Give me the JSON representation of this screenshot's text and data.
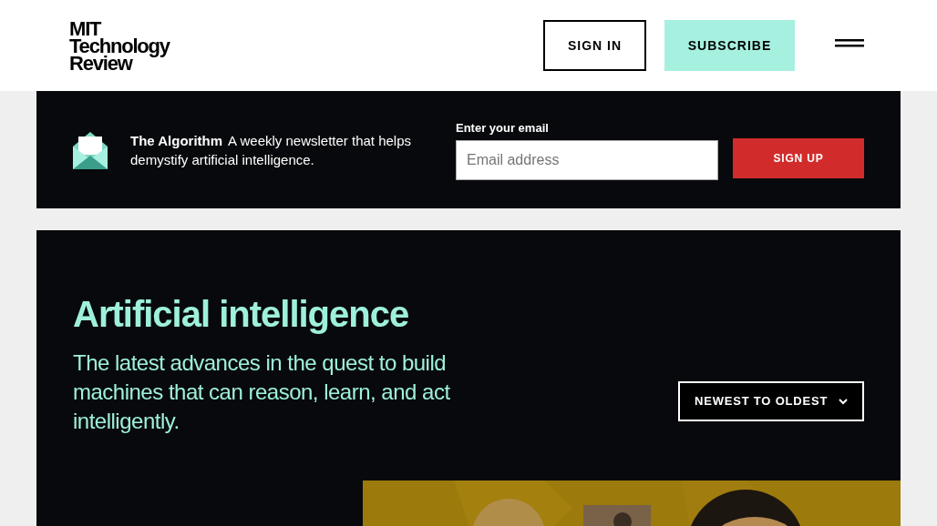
{
  "header": {
    "logo_lines": [
      "MIT",
      "Technology",
      "Review"
    ],
    "sign_in": "SIGN IN",
    "subscribe": "SUBSCRIBE"
  },
  "newsletter": {
    "name": "The Algorithm",
    "description": "A weekly newsletter that helps demystify artificial intelligence.",
    "email_label": "Enter your email",
    "email_placeholder": "Email address",
    "button": "SIGN UP"
  },
  "topic": {
    "title": "Artificial intelligence",
    "subtitle": "The latest advances in the quest to build machines that can reason, learn, and act intelligently.",
    "sort": "NEWEST TO OLDEST"
  }
}
